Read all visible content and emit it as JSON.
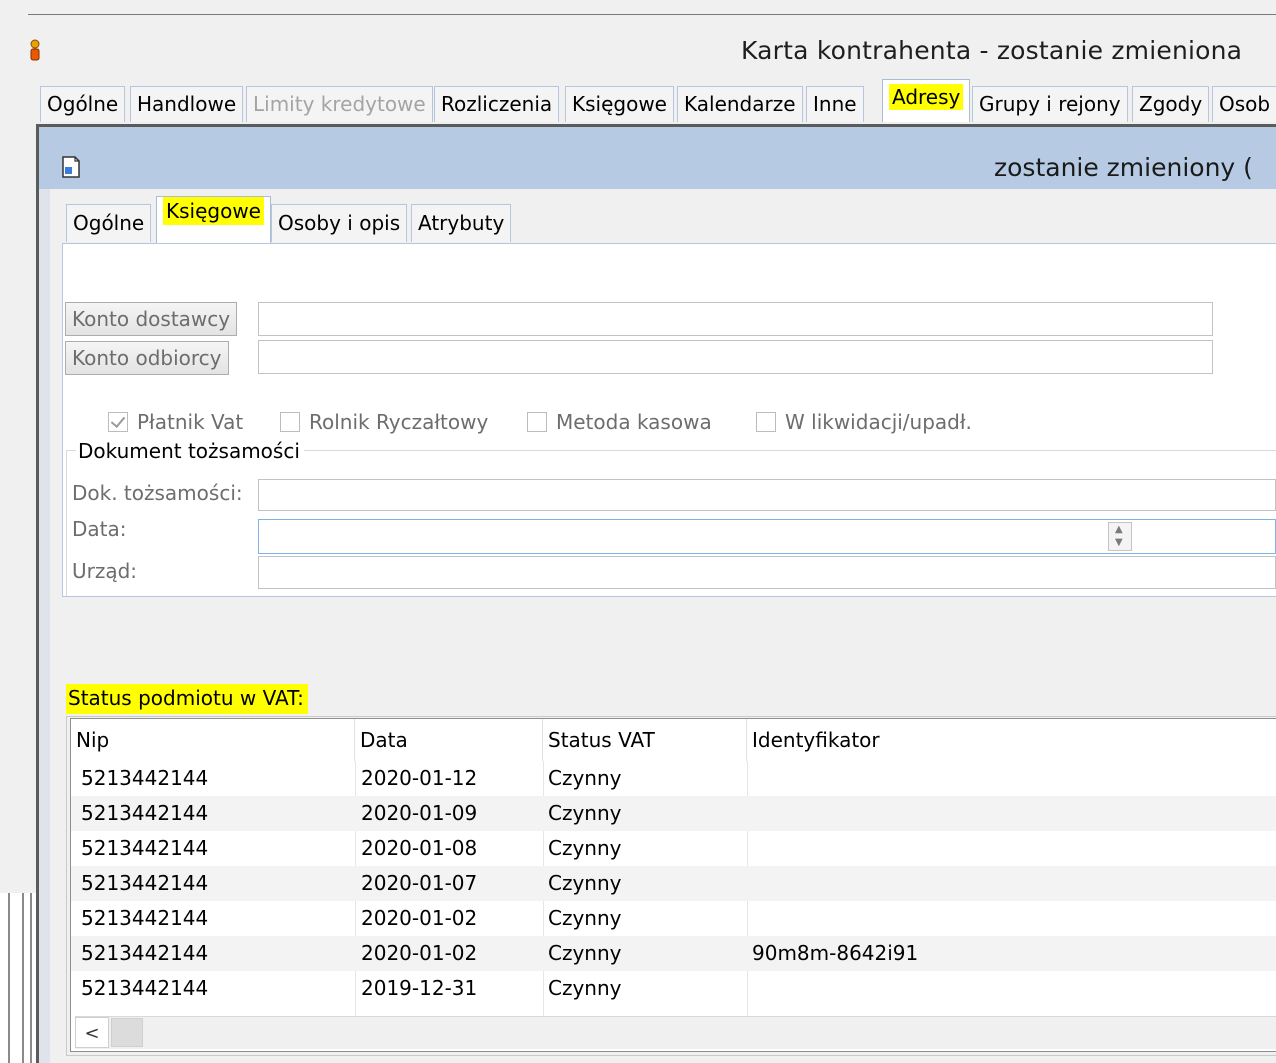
{
  "outer_window": {
    "title": "Karta kontrahenta - zostanie zmieniona",
    "tabs": [
      {
        "label": "Ogólne",
        "state": "normal"
      },
      {
        "label": "Handlowe",
        "state": "normal"
      },
      {
        "label": "Limity kredytowe",
        "state": "disabled"
      },
      {
        "label": "Rozliczenia",
        "state": "normal"
      },
      {
        "label": "Księgowe",
        "state": "normal"
      },
      {
        "label": "Kalendarze",
        "state": "normal"
      },
      {
        "label": "Inne",
        "state": "normal"
      },
      {
        "label": "Adresy",
        "state": "active"
      },
      {
        "label": "Grupy i rejony",
        "state": "normal"
      },
      {
        "label": "Zgody",
        "state": "normal"
      },
      {
        "label": "Osob",
        "state": "normal"
      }
    ]
  },
  "inner_window": {
    "title": "zostanie zmieniony (",
    "tabs": [
      {
        "label": "Ogólne",
        "state": "normal"
      },
      {
        "label": "Księgowe",
        "state": "active"
      },
      {
        "label": "Osoby i opis",
        "state": "normal"
      },
      {
        "label": "Atrybuty",
        "state": "normal"
      }
    ]
  },
  "accounts": {
    "supplier_button": "Konto dostawcy",
    "supplier_value": "",
    "buyer_button": "Konto odbiorcy",
    "buyer_value": ""
  },
  "checkboxes": [
    {
      "label": "Płatnik Vat",
      "checked": true
    },
    {
      "label": "Rolnik Ryczałtowy",
      "checked": false
    },
    {
      "label": "Metoda kasowa",
      "checked": false
    },
    {
      "label": "W likwidacji/upadł.",
      "checked": false
    }
  ],
  "identity_document": {
    "group_label": "Dokument tożsamości",
    "doc_label": "Dok. tożsamości:",
    "doc_value": "",
    "date_label": "Data:",
    "date_value": "",
    "office_label": "Urząd:",
    "office_value": ""
  },
  "vat_status": {
    "label": "Status podmiotu w VAT:",
    "columns": [
      "Nip",
      "Data",
      "Status VAT",
      "Identyfikator"
    ],
    "rows": [
      [
        "5213442144",
        "2020-01-12",
        "Czynny",
        ""
      ],
      [
        "5213442144",
        "2020-01-09",
        "Czynny",
        ""
      ],
      [
        "5213442144",
        "2020-01-08",
        "Czynny",
        ""
      ],
      [
        "5213442144",
        "2020-01-07",
        "Czynny",
        ""
      ],
      [
        "5213442144",
        "2020-01-02",
        "Czynny",
        ""
      ],
      [
        "5213442144",
        "2020-01-02",
        "Czynny",
        "90m8m-8642i91"
      ],
      [
        "5213442144",
        "2019-12-31",
        "Czynny",
        ""
      ]
    ],
    "scroll_left_label": "<"
  },
  "colors": {
    "highlight": "#ffff00",
    "title_bar": "#b6cbe3",
    "tab_border": "#b5c6de"
  }
}
